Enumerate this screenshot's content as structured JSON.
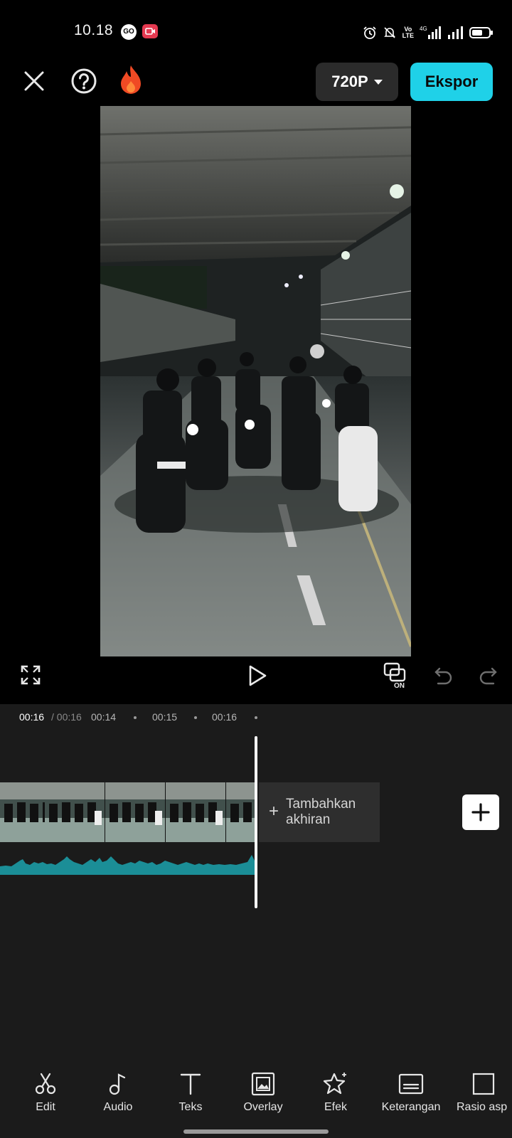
{
  "status_bar": {
    "time": "10.18",
    "go_badge": "GO",
    "volte": "Vo\nLTE",
    "network": "4G",
    "icons": [
      "alarm-icon",
      "mute-icon",
      "signal-icon",
      "battery-icon"
    ]
  },
  "topbar": {
    "resolution": "720P",
    "export_label": "Ekspor",
    "icons": [
      "close-icon",
      "help-icon",
      "fire-icon"
    ]
  },
  "timeline": {
    "current_time": "00:16",
    "total_time": "/ 00:16",
    "ticks": [
      "00:14",
      "00:15",
      "00:16"
    ],
    "add_ending_label": "Tambahkan akhiran",
    "add_ending_plus": "+"
  },
  "bottom_toolbar": {
    "items": [
      {
        "label": "Edit",
        "icon": "scissors-icon"
      },
      {
        "label": "Audio",
        "icon": "music-note-icon"
      },
      {
        "label": "Teks",
        "icon": "text-icon"
      },
      {
        "label": "Overlay",
        "icon": "overlay-icon"
      },
      {
        "label": "Efek",
        "icon": "effects-star-icon"
      },
      {
        "label": "Keterangan",
        "icon": "captions-icon"
      },
      {
        "label": "Rasio asp",
        "icon": "aspect-ratio-icon"
      }
    ]
  },
  "colors": {
    "accent": "#1fd1e8",
    "background": "#000000",
    "panel": "#1b1b1b",
    "waveform": "#1b8e97"
  }
}
